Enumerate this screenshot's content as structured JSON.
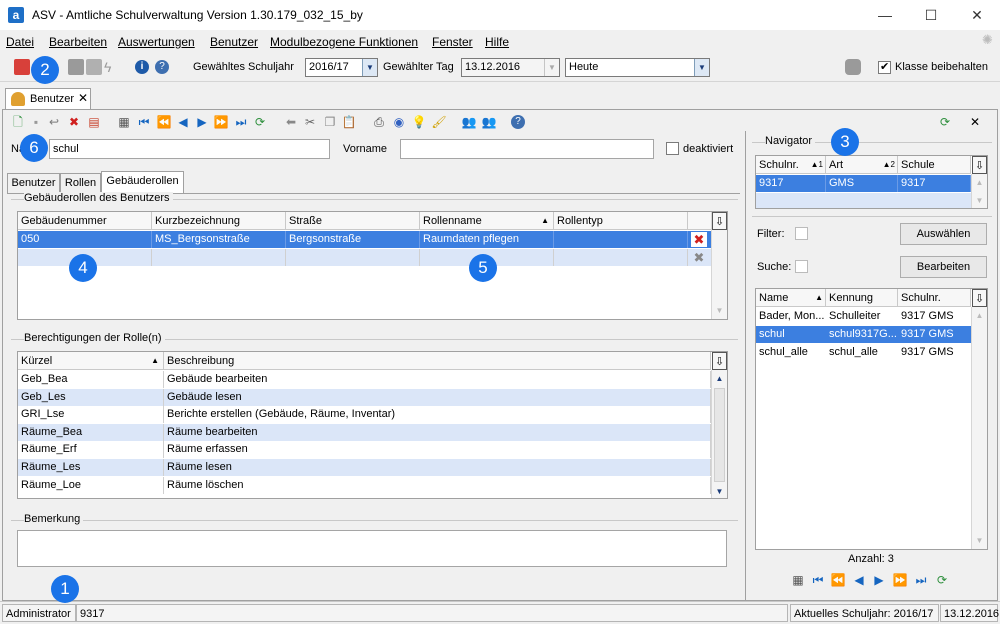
{
  "window": {
    "title": "ASV - Amtliche Schulverwaltung Version 1.30.179_032_15_by",
    "app_icon": "a"
  },
  "menu": [
    "Datei",
    "Bearbeiten",
    "Auswertungen",
    "Benutzer",
    "Modulbezogene Funktionen",
    "Fenster",
    "Hilfe"
  ],
  "toolbar": {
    "schuljahr_label": "Gewähltes Schuljahr",
    "schuljahr_value": "2016/17",
    "tag_label": "Gewählter Tag",
    "tag_value": "13.12.2016",
    "heute_value": "Heute",
    "klasse_label": "Klasse beibehalten"
  },
  "doc_tab": {
    "label": "Benutzer"
  },
  "form": {
    "name_label": "Name",
    "name_value": "schul",
    "vorname_label": "Vorname",
    "vorname_value": "",
    "deaktiviert_label": "deaktiviert"
  },
  "subtabs": [
    "Benutzer",
    "Rollen",
    "Gebäuderollen"
  ],
  "gebaeuderollen": {
    "title": "Gebäuderollen des Benutzers",
    "columns": [
      "Gebäudenummer",
      "Kurzbezeichnung",
      "Straße",
      "Rollenname",
      "Rollentyp"
    ],
    "rows": [
      [
        "050",
        "MS_Bergsonstraße",
        "Bergsonstraße",
        "Raumdaten pflegen",
        ""
      ]
    ]
  },
  "berechtigungen": {
    "title": "Berechtigungen der Rolle(n)",
    "columns": [
      "Kürzel",
      "Beschreibung"
    ],
    "rows": [
      [
        "Geb_Bea",
        "Gebäude bearbeiten"
      ],
      [
        "Geb_Les",
        "Gebäude lesen"
      ],
      [
        "GRI_Lse",
        "Berichte erstellen (Gebäude, Räume, Inventar)"
      ],
      [
        "Räume_Bea",
        "Räume bearbeiten"
      ],
      [
        "Räume_Erf",
        "Räume erfassen"
      ],
      [
        "Räume_Les",
        "Räume lesen"
      ],
      [
        "Räume_Loe",
        "Räume löschen"
      ]
    ]
  },
  "bemerkung": {
    "title": "Bemerkung",
    "value": ""
  },
  "navigator": {
    "title": "Navigator",
    "school_columns": [
      "Schulnr.",
      "Art",
      "Schule"
    ],
    "school_sort": [
      "1",
      "2"
    ],
    "school_rows": [
      [
        "9317",
        "GMS",
        "9317"
      ]
    ],
    "filter_label": "Filter:",
    "suche_label": "Suche:",
    "auswaehlen_label": "Auswählen",
    "bearbeiten_label": "Bearbeiten",
    "user_columns": [
      "Name",
      "Kennung",
      "Schulnr."
    ],
    "user_rows": [
      [
        "Bader, Mon...",
        "Schulleiter",
        "9317 GMS"
      ],
      [
        "schul",
        "schul9317G...",
        "9317 GMS"
      ],
      [
        "schul_alle",
        "schul_alle",
        "9317 GMS"
      ]
    ],
    "count_label": "Anzahl: 3"
  },
  "statusbar": {
    "user": "Administrator",
    "schulnr": "9317",
    "schuljahr": "Aktuelles Schuljahr: 2016/17",
    "date": "13.12.2016"
  },
  "badges": [
    "1",
    "2",
    "3",
    "4",
    "5",
    "6"
  ],
  "colors": {
    "selection": "#3c7fe0",
    "alt_row": "#dbe6f8",
    "badge": "#1a73e8"
  }
}
